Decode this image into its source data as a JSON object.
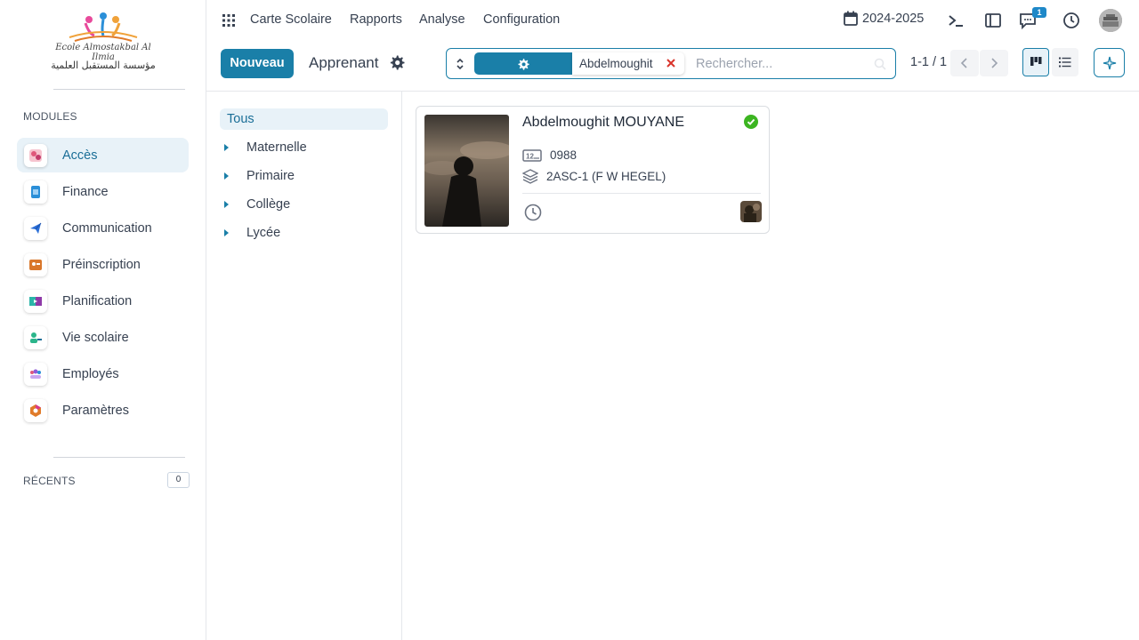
{
  "sidebar": {
    "logo": {
      "script_text": "Ecole Almostakbal Al Ilmia",
      "arabic_text": "مؤسسة المستقبل العلمية"
    },
    "modules_title": "MODULES",
    "modules": [
      {
        "label": "Accès",
        "icon": "access-icon",
        "active": true
      },
      {
        "label": "Finance",
        "icon": "finance-icon"
      },
      {
        "label": "Communication",
        "icon": "communication-icon"
      },
      {
        "label": "Préinscription",
        "icon": "preregistration-icon"
      },
      {
        "label": "Planification",
        "icon": "planning-icon"
      },
      {
        "label": "Vie scolaire",
        "icon": "school-life-icon"
      },
      {
        "label": "Employés",
        "icon": "employees-icon"
      },
      {
        "label": "Paramètres",
        "icon": "settings-icon"
      }
    ],
    "recent_title": "RÉCENTS",
    "recent_count": "0"
  },
  "topbar": {
    "menu": [
      "Carte Scolaire",
      "Rapports",
      "Analyse",
      "Configuration"
    ],
    "year": "2024-2025",
    "notification_count": "1"
  },
  "control": {
    "new_button": "Nouveau",
    "breadcrumb": "Apprenant",
    "search": {
      "facet_value": "Abdelmoughit",
      "placeholder": "Rechercher..."
    },
    "pager": "1-1 / 1"
  },
  "tree": {
    "all": "Tous",
    "items": [
      "Maternelle",
      "Primaire",
      "Collège",
      "Lycée"
    ]
  },
  "card": {
    "name": "Abdelmoughit MOUYANE",
    "number": "0988",
    "class": "2ASC-1 (F W HEGEL)",
    "status": "active"
  },
  "colors": {
    "primary": "#1a7fa8",
    "active_bg": "#e8f2f8",
    "success": "#3cb521",
    "danger": "#d9342b"
  }
}
